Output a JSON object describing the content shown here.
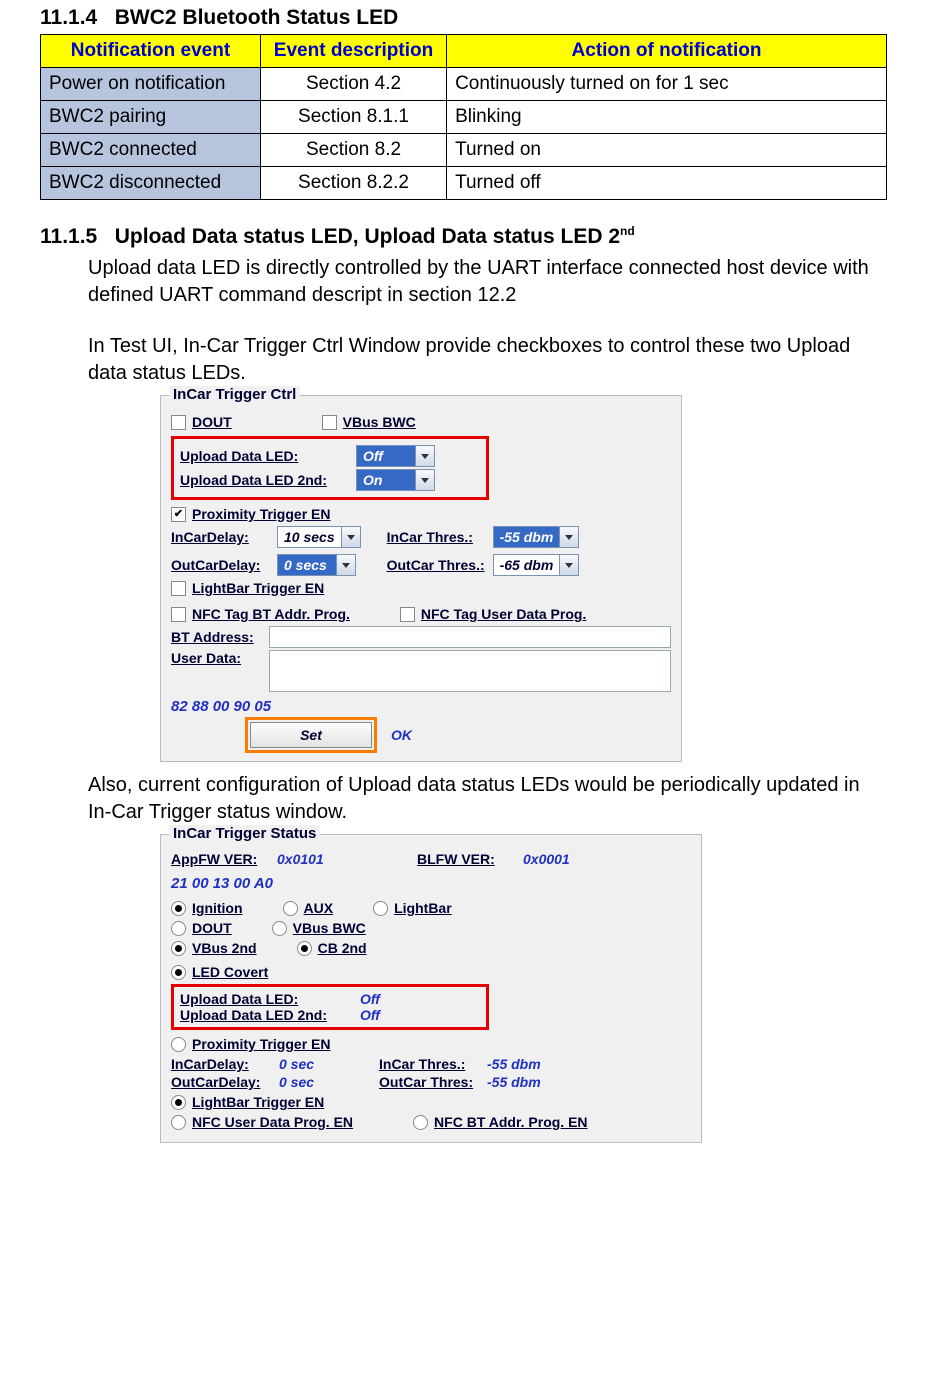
{
  "section1": {
    "num": "11.1.4",
    "title": "BWC2 Bluetooth Status LED"
  },
  "table": {
    "headers": [
      "Notification event",
      "Event description",
      "Action of notification"
    ],
    "rows": [
      {
        "event": "Power on notification",
        "desc": "Section 4.2",
        "action": "Continuously turned on for 1 sec"
      },
      {
        "event": "BWC2 pairing",
        "desc": "Section 8.1.1",
        "action": "Blinking"
      },
      {
        "event": "BWC2 connected",
        "desc": "Section 8.2",
        "action": "Turned on"
      },
      {
        "event": "BWC2 disconnected",
        "desc": "Section 8.2.2",
        "action": "Turned off"
      }
    ]
  },
  "section2": {
    "num": "11.1.5",
    "title_a": "Upload Data status LED, Upload Data status LED 2",
    "title_sup": "nd"
  },
  "para1": "Upload data LED is directly controlled by the UART interface connected host device with defined UART command descript in section 12.2",
  "para2": "In Test UI, In-Car Trigger Ctrl Window provide checkboxes to control these two Upload data status LEDs.",
  "ctrl": {
    "title": "InCar Trigger Ctrl",
    "dout": "DOUT",
    "vbusbwc": "VBus BWC",
    "uled_lbl": "Upload Data LED:",
    "uled_val": "Off",
    "uled2_lbl": "Upload Data LED 2nd:",
    "uled2_val": "On",
    "prox": "Proximity Trigger EN",
    "incardelay_lbl": "InCarDelay:",
    "incardelay_val": "10 secs",
    "outcardelay_lbl": "OutCarDelay:",
    "outcardelay_val": "0 secs",
    "incarthres_lbl": "InCar Thres.:",
    "incarthres_val": "-55 dbm",
    "outcarthres_lbl": "OutCar Thres.:",
    "outcarthres_val": "-65 dbm",
    "lightbar": "LightBar Trigger EN",
    "nfcbt": "NFC Tag BT Addr. Prog.",
    "nfcuser": "NFC Tag User Data Prog.",
    "btaddr_lbl": "BT Address:",
    "userdata_lbl": "User Data:",
    "hex": "82 88 00 90 05",
    "set": "Set",
    "ok": "OK"
  },
  "para3": "Also, current configuration of Upload data status LEDs would be periodically updated in In-Car Trigger status window.",
  "status": {
    "title": "InCar Trigger Status",
    "appfw_lbl": "AppFW VER:",
    "appfw_val": "0x0101",
    "blfw_lbl": "BLFW VER:",
    "blfw_val": "0x0001",
    "hex": "21 00 13 00 A0",
    "r_ignition": "Ignition",
    "r_aux": "AUX",
    "r_lightbar": "LightBar",
    "r_dout": "DOUT",
    "r_vbusbwc": "VBus BWC",
    "r_vbus2nd": "VBus 2nd",
    "r_cb2nd": "CB 2nd",
    "r_ledcovert": "LED Covert",
    "uled_lbl": "Upload Data LED:",
    "uled_val": "Off",
    "uled2_lbl": "Upload Data LED 2nd:",
    "uled2_val": "Off",
    "r_prox": "Proximity Trigger EN",
    "incardelay_lbl": "InCarDelay:",
    "incardelay_val": "0 sec",
    "incarthres_lbl": "InCar Thres.:",
    "incarthres_val": "-55 dbm",
    "outcardelay_lbl": "OutCarDelay:",
    "outcardelay_val": "0 sec",
    "outcarthres_lbl": "OutCar Thres:",
    "outcarthres_val": "-55 dbm",
    "r_lightbar_en": "LightBar Trigger EN",
    "r_nfcuser": "NFC User Data Prog. EN",
    "r_nfcbt": "NFC BT Addr. Prog. EN"
  }
}
